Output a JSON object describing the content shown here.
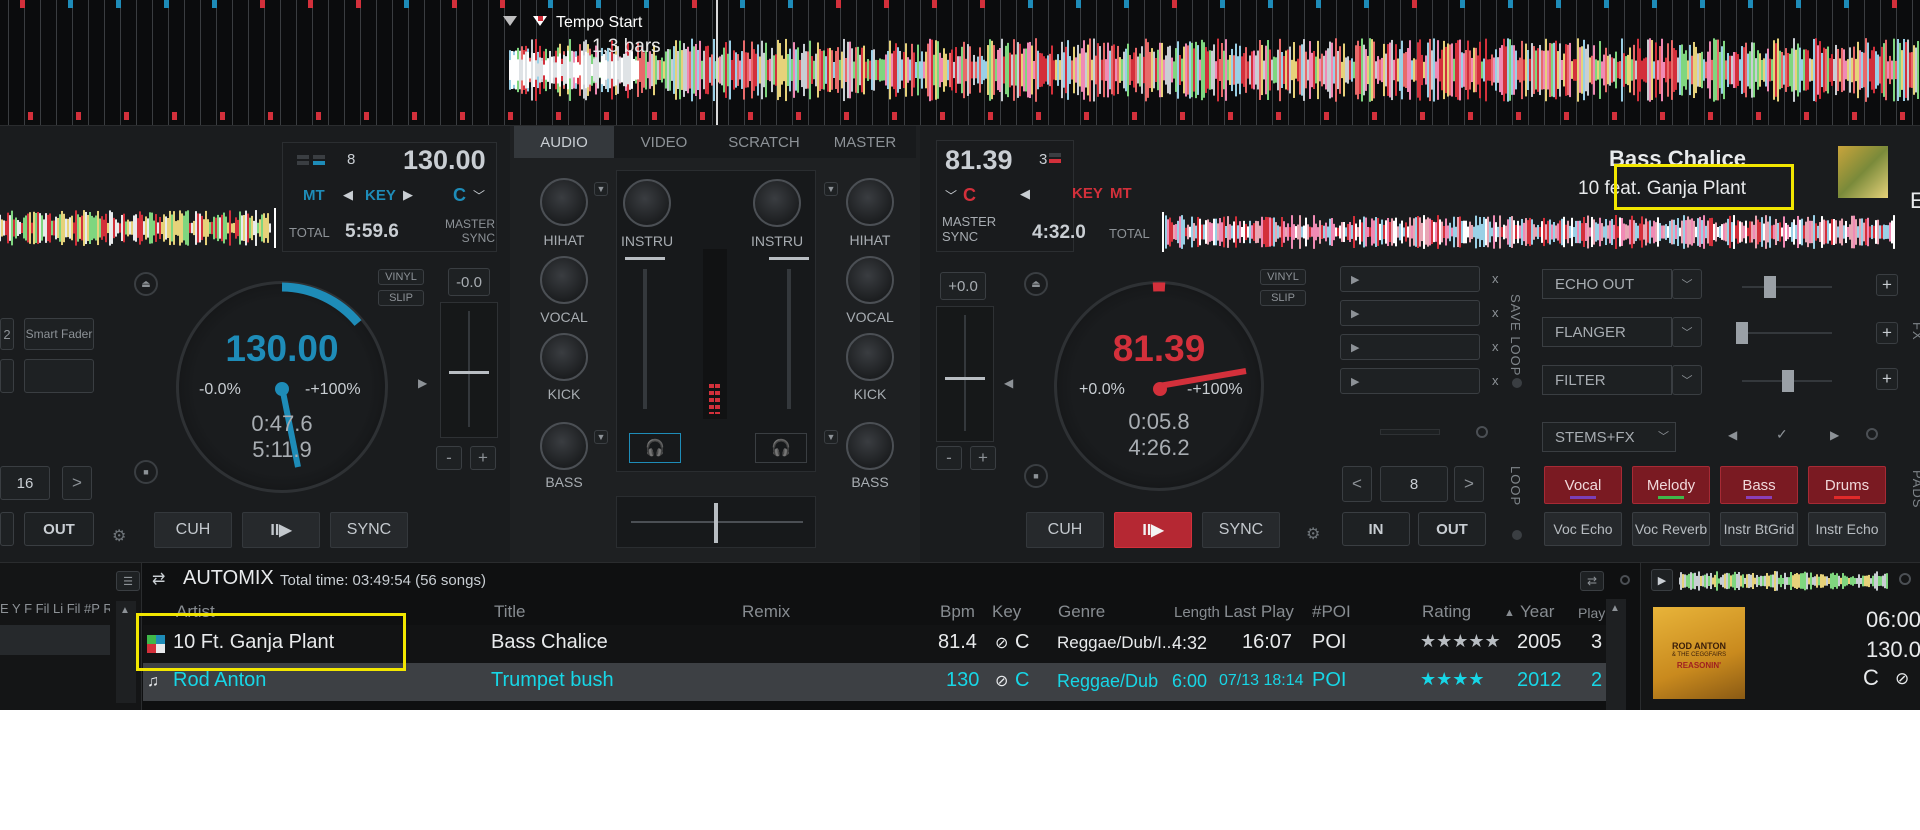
{
  "overview": {
    "tempo_start_label": "Tempo Start",
    "bars_label": "1.3 bars"
  },
  "left_deck": {
    "key_number": "8",
    "bpm": "130.00",
    "mt": "MT",
    "key_label": "KEY",
    "key_value": "C",
    "total_label": "TOTAL",
    "total_time": "5:59.6",
    "master_sync": "MASTER SYNC",
    "pitch_value": "-0.0",
    "vinyl": "VINYL",
    "slip": "SLIP",
    "jog_bpm": "130.00",
    "jog_pitch_left": "-0.0%",
    "jog_pitch_range": "-+100%",
    "jog_time_elapsed": "0:47.6",
    "jog_time_remaining": "5:11.9",
    "cue": "CUH",
    "play": "II▶",
    "sync": "SYNC",
    "minus": "-",
    "plus": "+",
    "loop_size": "16",
    "next": ">",
    "out": "OUT",
    "smart_fader": "Smart Fader",
    "num_2": "2"
  },
  "mixer": {
    "tabs": [
      "AUDIO",
      "VIDEO",
      "SCRATCH",
      "MASTER"
    ],
    "left": {
      "hihat": "HIHAT",
      "vocal": "VOCAL",
      "kick": "KICK",
      "bass": "BASS"
    },
    "instru_left": "INSTRU",
    "instru_right": "INSTRU",
    "right": {
      "hihat": "HIHAT",
      "vocal": "VOCAL",
      "kick": "KICK",
      "bass": "BASS"
    }
  },
  "right_deck": {
    "bpm": "81.39",
    "key_number": "3",
    "key_value": "C",
    "key_label": "KEY",
    "mt": "MT",
    "master_sync": "MASTER SYNC",
    "total_time": "4:32.0",
    "total_label": "TOTAL",
    "title": "Bass Chalice",
    "artist": "10 feat. Ganja Plant",
    "pitch_value": "+0.0",
    "vinyl": "VINYL",
    "slip": "SLIP",
    "jog_bpm": "81.39",
    "jog_pitch_left": "+0.0%",
    "jog_pitch_range": "-+100%",
    "jog_time_elapsed": "0:05.8",
    "jog_time_remaining": "4:26.2",
    "cue": "CUH",
    "play": "II▶",
    "sync": "SYNC",
    "minus": "-",
    "plus": "+",
    "prev": "<",
    "loop_size": "8",
    "next": ">",
    "in": "IN",
    "out": "OUT",
    "save_loop": "SAVE LOOP",
    "loop": "LOOP",
    "pads_label": "PADS",
    "fx_label": "FX",
    "x": "x",
    "fx": [
      "ECHO OUT",
      "FLANGER",
      "FILTER"
    ],
    "fx_plus": "+",
    "stems_select": "STEMS+FX",
    "pads_row1": [
      "Vocal",
      "Melody",
      "Bass",
      "Drums"
    ],
    "pads_row2": [
      "Voc Echo",
      "Voc Reverb",
      "Instr BtGrid",
      "Instr Echo"
    ],
    "edge_letter": "E"
  },
  "browser": {
    "automix_title": "AUTOMIX",
    "total_time": "Total time: 03:49:54 (56 songs)",
    "columns": {
      "artist": "Artist",
      "title": "Title",
      "remix": "Remix",
      "bpm": "Bpm",
      "key": "Key",
      "genre": "Genre",
      "length": "Length",
      "last_play": "Last Play",
      "poi": "#POI",
      "rating": "Rating",
      "year": "Year",
      "play": "Play"
    },
    "left_mini_headers": "E Y F Fil Li Fil #P R",
    "rows": [
      {
        "artist": "10 Ft. Ganja Plant",
        "title": "Bass Chalice",
        "bpm": "81.4",
        "key": "C",
        "genre": "Reggae/Dub/I...",
        "length": "4:32",
        "last_play": "16:07",
        "poi": "POI",
        "rating": 5,
        "year": "2005",
        "play": "3"
      },
      {
        "artist": "Rod Anton",
        "title": "Trumpet bush",
        "bpm": "130",
        "key": "C",
        "genre": "Reggae/Dub",
        "length": "6:00",
        "last_play": "07/13 18:14",
        "poi": "POI",
        "rating": 4,
        "year": "2012",
        "play": "2"
      }
    ],
    "preview": {
      "time": "06:00",
      "bpm": "130.0",
      "key": "C",
      "cover_line1": "ROD ANTON",
      "cover_line2": "& THE CEGGFAIRS",
      "cover_line3": "REASONIN'"
    }
  },
  "colors": {
    "deck_left": "#1e8cb8",
    "deck_right": "#d3303b",
    "highlight": "#f2e600",
    "selected_row_text": "#17d6e6"
  }
}
